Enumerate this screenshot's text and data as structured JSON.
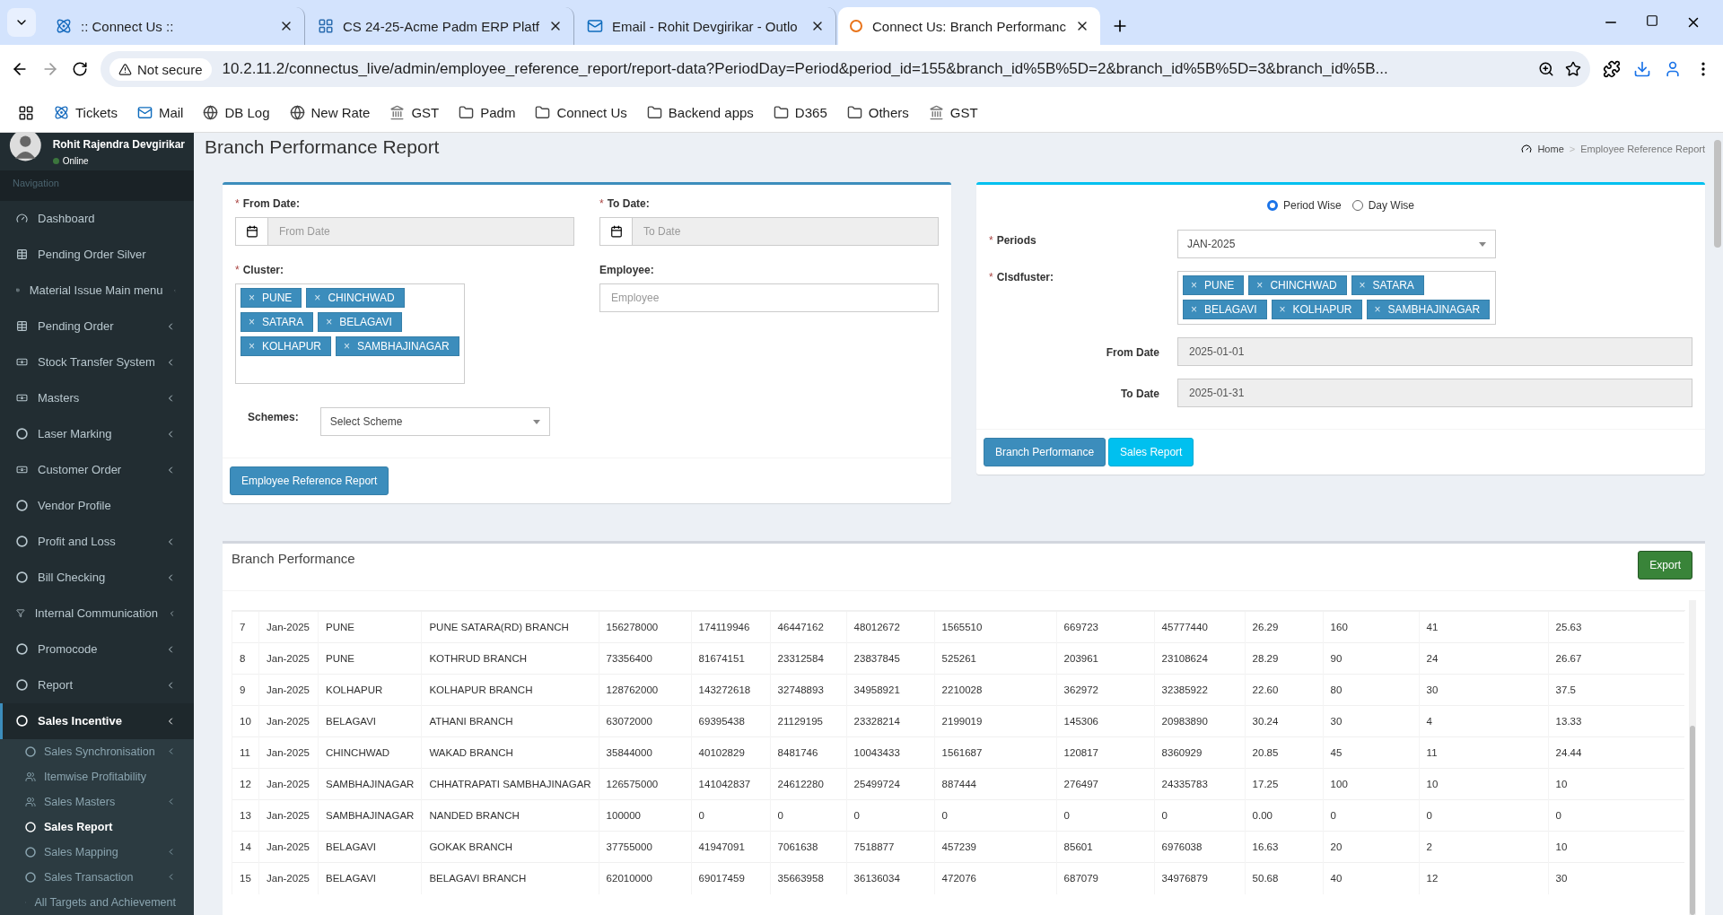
{
  "browser": {
    "tabs": [
      {
        "title": ":: Connect Us ::",
        "selected": false
      },
      {
        "title": "CS 24-25-Acme Padm ERP Platf",
        "selected": false
      },
      {
        "title": "Email - Rohit Devgirikar - Outlo",
        "selected": false
      },
      {
        "title": "Connect Us: Branch Performanc",
        "selected": true
      }
    ],
    "security": "Not secure",
    "url": "10.2.11.2/connectus_live/admin/employee_reference_report/report-data?PeriodDay=Period&period_id=155&branch_id%5B%5D=2&branch_id%5B%5D=3&branch_id%5B...",
    "bookmarks": [
      {
        "label": "Tickets",
        "kind": "react"
      },
      {
        "label": "Mail",
        "kind": "mail"
      },
      {
        "label": "DB Log",
        "kind": "globe"
      },
      {
        "label": "New Rate",
        "kind": "globe"
      },
      {
        "label": "GST",
        "kind": "emblem"
      },
      {
        "label": "Padm",
        "kind": "folder"
      },
      {
        "label": "Connect Us",
        "kind": "folder"
      },
      {
        "label": "Backend apps",
        "kind": "folder"
      },
      {
        "label": "D365",
        "kind": "folder"
      },
      {
        "label": "Others",
        "kind": "folder"
      },
      {
        "label": "GST",
        "kind": "emblem"
      }
    ]
  },
  "sidebar": {
    "user": {
      "name": "Rohit Rajendra Devgirikar",
      "status": "Online"
    },
    "header": "Navigation",
    "items": [
      {
        "label": "Dashboard",
        "caret": false,
        "selected": false
      },
      {
        "label": "Pending Order Silver",
        "caret": false,
        "selected": false
      },
      {
        "label": "Material Issue Main menu",
        "caret": true,
        "selected": false
      },
      {
        "label": "Pending Order",
        "caret": true,
        "selected": false
      },
      {
        "label": "Stock Transfer System",
        "caret": true,
        "selected": false
      },
      {
        "label": "Masters",
        "caret": true,
        "selected": false
      },
      {
        "label": "Laser Marking",
        "caret": true,
        "selected": false
      },
      {
        "label": "Customer Order",
        "caret": true,
        "selected": false
      },
      {
        "label": "Vendor Profile",
        "caret": false,
        "selected": false
      },
      {
        "label": "Profit and Loss",
        "caret": true,
        "selected": false
      },
      {
        "label": "Bill Checking",
        "caret": true,
        "selected": false
      },
      {
        "label": "Internal Communication",
        "caret": true,
        "selected": false
      },
      {
        "label": "Promocode",
        "caret": true,
        "selected": false
      },
      {
        "label": "Report",
        "caret": true,
        "selected": false
      },
      {
        "label": "Sales Incentive",
        "caret": true,
        "selected": true,
        "children": [
          {
            "label": "Sales Synchronisation",
            "caret": true,
            "selected": false
          },
          {
            "label": "Itemwise Profitability",
            "caret": false,
            "selected": false
          },
          {
            "label": "Sales Masters",
            "caret": true,
            "selected": false
          },
          {
            "label": "Sales Report",
            "caret": false,
            "selected": true
          },
          {
            "label": "Sales Mapping",
            "caret": true,
            "selected": false
          },
          {
            "label": "Sales Transaction",
            "caret": true,
            "selected": false
          },
          {
            "label": "All Targets and Achievement",
            "caret": false,
            "selected": false
          }
        ]
      }
    ]
  },
  "page": {
    "title": "Branch Performance Report",
    "breadcrumb": [
      {
        "label": "Home"
      },
      {
        "label": "Employee Reference Report"
      }
    ],
    "separator": ">",
    "required_mark": "*"
  },
  "left_form": {
    "from_date": {
      "label": "From Date:",
      "placeholder": "From Date",
      "required": true
    },
    "to_date": {
      "label": "To Date:",
      "placeholder": "To Date",
      "required": true
    },
    "cluster": {
      "label": "Cluster:",
      "required": true,
      "remove_mark": "×",
      "tags": [
        "PUNE",
        "CHINCHWAD",
        "SATARA",
        "BELAGAVI",
        "KOLHAPUR",
        "SAMBHAJINAGAR"
      ]
    },
    "employee": {
      "label": "Employee:",
      "placeholder": "Employee",
      "required": false
    },
    "schemes": {
      "label": "Schemes:",
      "value": "Select Scheme"
    },
    "button": "Employee Reference Report"
  },
  "right_form": {
    "radios": [
      {
        "label": "Period Wise",
        "selected": true
      },
      {
        "label": "Day Wise",
        "selected": false
      }
    ],
    "periods": {
      "label": "Periods",
      "value": "JAN-2025",
      "required": true
    },
    "cluster": {
      "label": "Clsdfuster:",
      "required": true,
      "remove_mark": "×",
      "tags": [
        "PUNE",
        "CHINCHWAD",
        "SATARA",
        "BELAGAVI",
        "KOLHAPUR",
        "SAMBHAJINAGAR"
      ]
    },
    "from_date": {
      "label": "From Date",
      "value": "2025-01-01"
    },
    "to_date": {
      "label": "To Date",
      "value": "2025-01-31"
    },
    "buttons": [
      {
        "label": "Branch Performance",
        "kind": "primary"
      },
      {
        "label": "Sales Report",
        "kind": "info"
      }
    ]
  },
  "table_panel": {
    "title": "Branch Performance",
    "export": "Export",
    "rows": [
      [
        "7",
        "Jan-2025",
        "PUNE",
        "PUNE SATARA(RD) BRANCH",
        "156278000",
        "174119946",
        "46447162",
        "48012672",
        "1565510",
        "669723",
        "45777440",
        "26.29",
        "160",
        "41",
        "25.63"
      ],
      [
        "8",
        "Jan-2025",
        "PUNE",
        "KOTHRUD BRANCH",
        "73356400",
        "81674151",
        "23312584",
        "23837845",
        "525261",
        "203961",
        "23108624",
        "28.29",
        "90",
        "24",
        "26.67"
      ],
      [
        "9",
        "Jan-2025",
        "KOLHAPUR",
        "KOLHAPUR BRANCH",
        "128762000",
        "143272618",
        "32748893",
        "34958921",
        "2210028",
        "362972",
        "32385922",
        "22.60",
        "80",
        "30",
        "37.5"
      ],
      [
        "10",
        "Jan-2025",
        "BELAGAVI",
        "ATHANI BRANCH",
        "63072000",
        "69395438",
        "21129195",
        "23328214",
        "2199019",
        "145306",
        "20983890",
        "30.24",
        "30",
        "4",
        "13.33"
      ],
      [
        "11",
        "Jan-2025",
        "CHINCHWAD",
        "WAKAD BRANCH",
        "35844000",
        "40102829",
        "8481746",
        "10043433",
        "1561687",
        "120817",
        "8360929",
        "20.85",
        "45",
        "11",
        "24.44"
      ],
      [
        "12",
        "Jan-2025",
        "SAMBHAJINAGAR",
        "CHHATRAPATI SAMBHAJINAGAR",
        "126575000",
        "141042837",
        "24612280",
        "25499724",
        "887444",
        "276497",
        "24335783",
        "17.25",
        "100",
        "10",
        "10"
      ],
      [
        "13",
        "Jan-2025",
        "SAMBHAJINAGAR",
        "NANDED BRANCH",
        "100000",
        "0",
        "0",
        "0",
        "0",
        "0",
        "0",
        "0.00",
        "0",
        "0",
        "0"
      ],
      [
        "14",
        "Jan-2025",
        "BELAGAVI",
        "GOKAK BRANCH",
        "37755000",
        "41947091",
        "7061638",
        "7518877",
        "457239",
        "85601",
        "6976038",
        "16.63",
        "20",
        "2",
        "10"
      ],
      [
        "15",
        "Jan-2025",
        "BELAGAVI",
        "BELAGAVI BRANCH",
        "62010000",
        "69017459",
        "35663958",
        "36136034",
        "472076",
        "687079",
        "34976879",
        "50.68",
        "40",
        "12",
        "30"
      ]
    ]
  }
}
